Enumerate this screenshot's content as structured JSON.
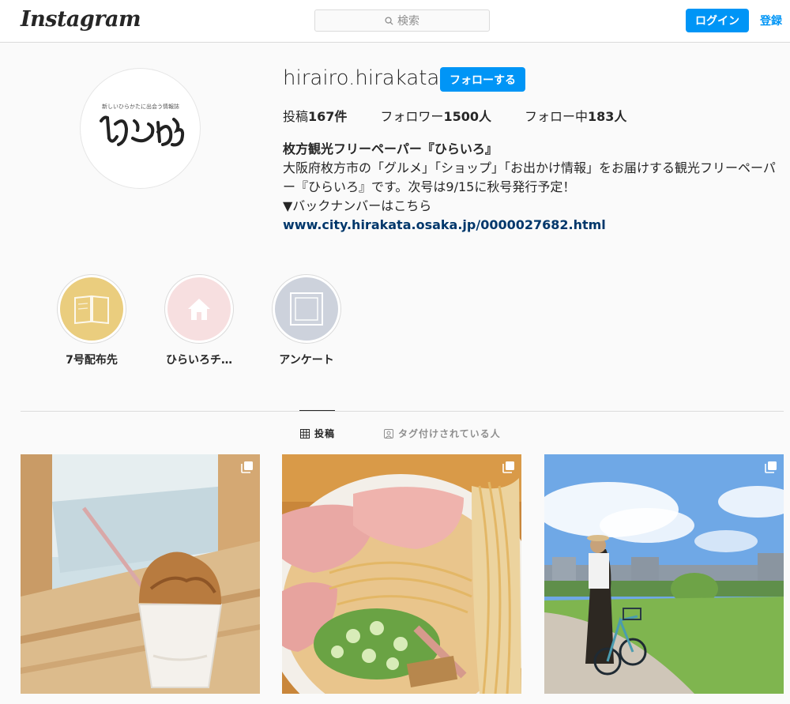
{
  "nav": {
    "logo": "Instagram",
    "search_placeholder": "検索",
    "login_label": "ログイン",
    "signup_label": "登録"
  },
  "profile": {
    "avatar_text": "ひらいろ",
    "avatar_tagline": "新しいひらかたに出会う情報誌",
    "username": "hirairo.hirakata",
    "follow_label": "フォローする",
    "posts_label": "投稿",
    "posts_count": "167件",
    "followers_label": "フォロワー",
    "followers_count": "1500人",
    "following_label": "フォロー中",
    "following_count": "183人",
    "bio_name": "枚方観光フリーペーパー『ひらいろ』",
    "bio_text": "大阪府枚方市の「グルメ」「ショップ」「お出かけ情報」をお届けする観光フリーペーパー『ひらいろ』です。次号は9/15に秋号発行予定！",
    "bio_note": "▼バックナンバーはこちら",
    "bio_link": "www.city.hirakata.osaka.jp/0000027682.html"
  },
  "highlights": [
    {
      "label": "7号配布先",
      "color": "#eacd7e"
    },
    {
      "label": "ひらいろチ…",
      "color": "#f7dfe0"
    },
    {
      "label": "アンケート",
      "color": "#cdd2dc"
    }
  ],
  "tabs": {
    "posts": "投稿",
    "tagged": "タグ付けされている人"
  },
  "posts": [
    {
      "icon": "multiple-posts-icon"
    },
    {
      "icon": "multiple-posts-icon"
    },
    {
      "icon": "multiple-posts-icon"
    }
  ],
  "colors": {
    "accent": "#0095f6",
    "link": "#00376b",
    "background": "#fafafa"
  }
}
